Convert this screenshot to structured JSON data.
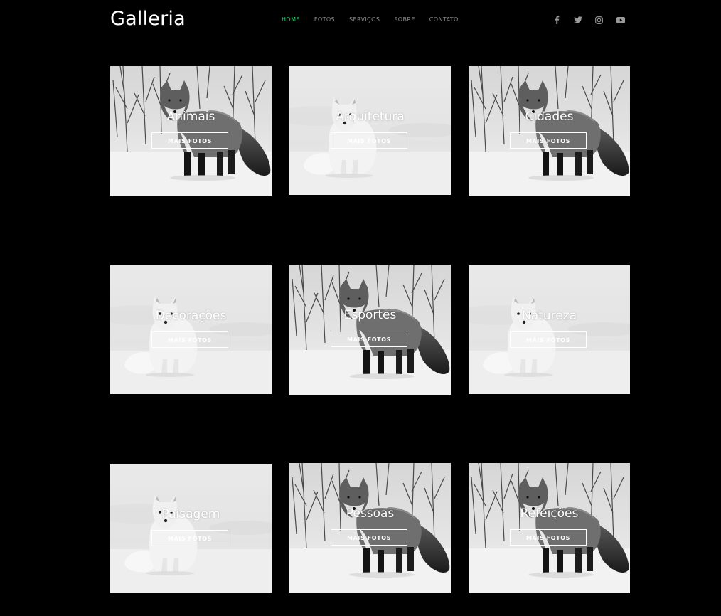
{
  "header": {
    "logo": "Galleria",
    "nav": [
      {
        "label": "HOME",
        "active": true
      },
      {
        "label": "FOTOS",
        "active": false
      },
      {
        "label": "SERVIÇOS",
        "active": false
      },
      {
        "label": "SOBRE",
        "active": false
      },
      {
        "label": "CONTATO",
        "active": false
      }
    ],
    "social": [
      "facebook-icon",
      "twitter-icon",
      "instagram-icon",
      "youtube-icon"
    ]
  },
  "colors": {
    "background": "#000000",
    "nav_active": "#2ecc71",
    "nav_inactive": "#8f8f8f",
    "text": "#ffffff"
  },
  "gallery": {
    "button_label": "MAIS FOTOS",
    "items": [
      {
        "title": "Animais",
        "image": "gray-fox"
      },
      {
        "title": "Arquitetura",
        "image": "white-fox"
      },
      {
        "title": "Cidades",
        "image": "gray-fox"
      },
      {
        "title": "Decorações",
        "image": "white-fox"
      },
      {
        "title": "Esportes",
        "image": "gray-fox"
      },
      {
        "title": "Natureza",
        "image": "white-fox"
      },
      {
        "title": "Paisagem",
        "image": "white-fox"
      },
      {
        "title": "Pessoas",
        "image": "gray-fox"
      },
      {
        "title": "Refeições",
        "image": "gray-fox"
      }
    ]
  }
}
